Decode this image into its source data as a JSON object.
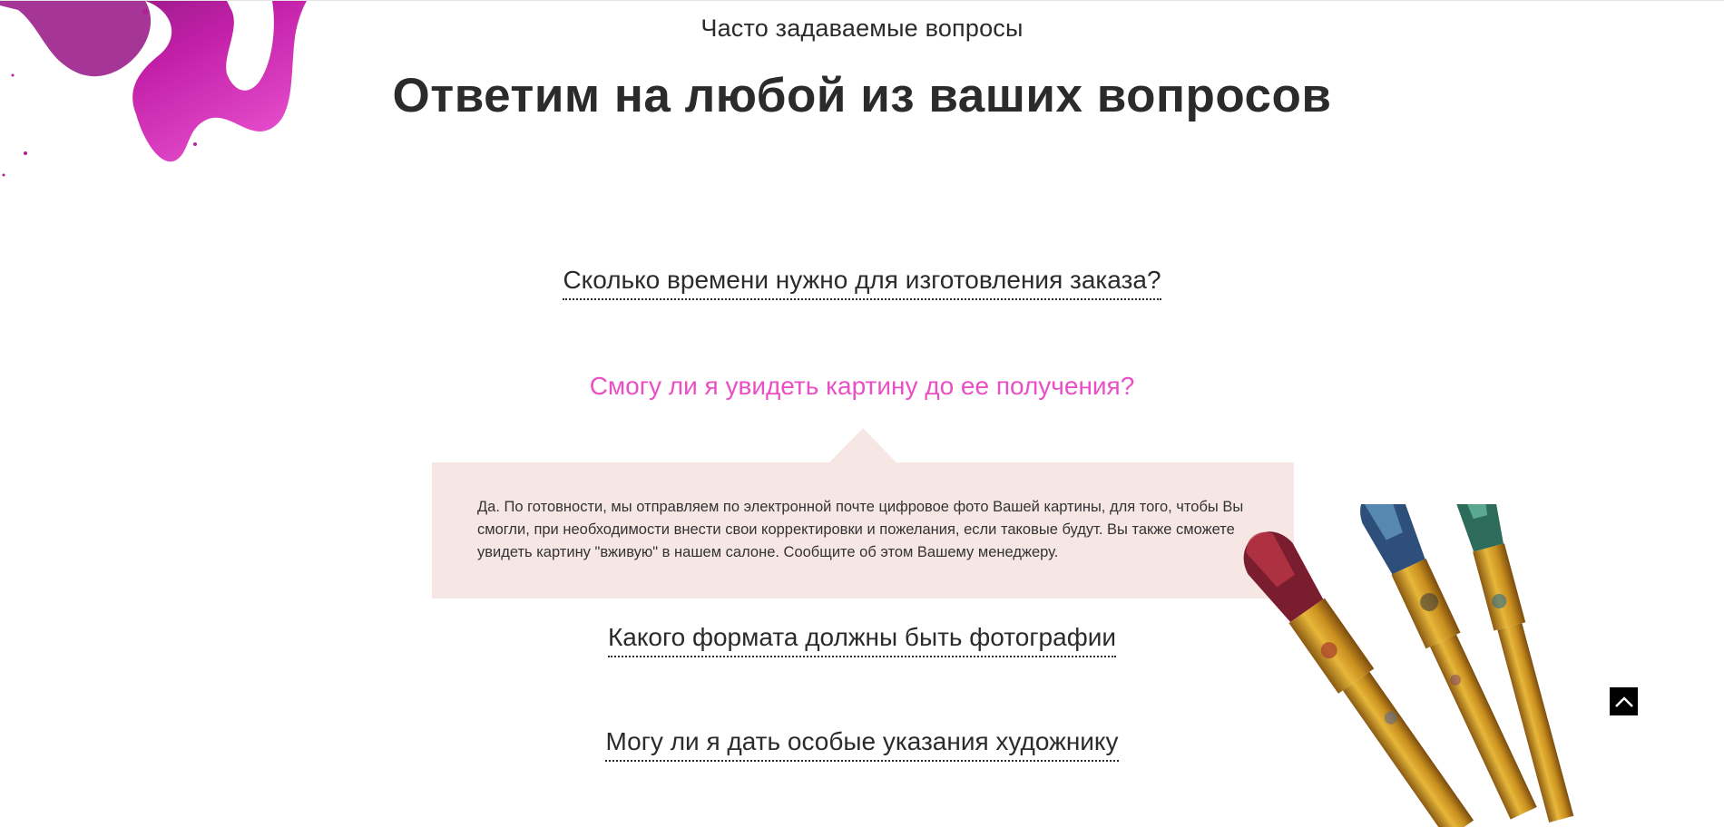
{
  "section": {
    "eyebrow": "Часто задаваемые вопросы",
    "title": "Ответим на любой из ваших вопросов"
  },
  "faq": {
    "items": [
      {
        "question": "Сколько времени нужно для изготовления заказа?",
        "expanded": false
      },
      {
        "question": "Смогу ли я увидеть картину до ее получения?",
        "expanded": true,
        "answer": "Да. По готовности, мы отправляем по электронной почте цифровое фото Вашей картины, для того, чтобы Вы смогли, при необходимости внести свои корректировки и пожелания, если таковые будут. Вы также сможете увидеть картину \"вживую\" в нашем салоне. Сообщите об этом Вашему менеджеру."
      },
      {
        "question": "Какого формата должны быть фотографии",
        "expanded": false
      },
      {
        "question": "Могу ли я дать особые указания художнику",
        "expanded": false
      }
    ]
  },
  "colors": {
    "accent": "#ea4fc6",
    "answer_bg": "#f6e7e5",
    "text": "#2b2b2b"
  },
  "icons": {
    "scroll_top": "chevron-up-icon"
  }
}
